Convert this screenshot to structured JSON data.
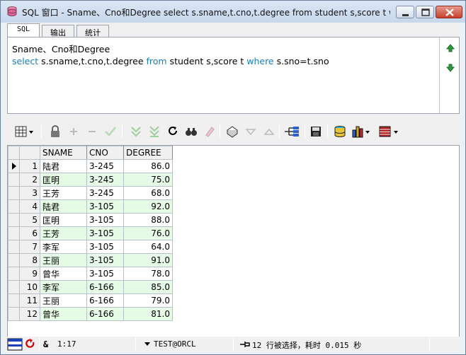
{
  "window": {
    "title": "SQL 窗口 - Sname、Cno和Degree select s.sname,t.cno,t.degree from student s,score t w..."
  },
  "tabs": [
    "SQL",
    "输出",
    "统计"
  ],
  "sql_editor": {
    "comment_line": "Sname、Cno和Degree",
    "query": {
      "kw_select": "select",
      "cols": " s.sname,t.cno,t.degree ",
      "kw_from": "from",
      "tables": " student s,score t  ",
      "kw_where": "where",
      "cond": " s.sno=t.sno"
    }
  },
  "toolbar": {
    "icons": [
      "grid-menu-icon",
      "lock-icon",
      "add-row-icon",
      "delete-row-icon",
      "post-icon",
      "fetch-next-icon",
      "fetch-all-icon",
      "refresh-icon",
      "find-icon",
      "clear-icon",
      "query-by-example-icon",
      "sort-down-icon",
      "sort-up-icon",
      "tree-icon",
      "save-icon",
      "export-icon",
      "chart-icon",
      "single-record-icon"
    ]
  },
  "grid": {
    "headers": [
      "SNAME",
      "CNO",
      "DEGREE"
    ],
    "rows": [
      {
        "n": "1",
        "sname": "陆君",
        "cno": "3-245",
        "degree": "86.0"
      },
      {
        "n": "2",
        "sname": "匡明",
        "cno": "3-245",
        "degree": "75.0"
      },
      {
        "n": "3",
        "sname": "王芳",
        "cno": "3-245",
        "degree": "68.0"
      },
      {
        "n": "4",
        "sname": "陆君",
        "cno": "3-105",
        "degree": "92.0"
      },
      {
        "n": "5",
        "sname": "匡明",
        "cno": "3-105",
        "degree": "88.0"
      },
      {
        "n": "6",
        "sname": "王芳",
        "cno": "3-105",
        "degree": "76.0"
      },
      {
        "n": "7",
        "sname": "李军",
        "cno": "3-105",
        "degree": "64.0"
      },
      {
        "n": "8",
        "sname": "王丽",
        "cno": "3-105",
        "degree": "91.0"
      },
      {
        "n": "9",
        "sname": "曾华",
        "cno": "3-105",
        "degree": "78.0"
      },
      {
        "n": "10",
        "sname": "李军",
        "cno": "6-166",
        "degree": "85.0"
      },
      {
        "n": "11",
        "sname": "王丽",
        "cno": "6-166",
        "degree": "79.0"
      },
      {
        "n": "12",
        "sname": "曾华",
        "cno": "6-166",
        "degree": "81.0"
      }
    ]
  },
  "status": {
    "cursor": "1:17",
    "connection": "TEST@ORCL",
    "message": "12 行被选择，耗时 0.015 秒"
  },
  "colors": {
    "keyword": "#1a7fb5",
    "alt_row": "#e6fbe6"
  }
}
